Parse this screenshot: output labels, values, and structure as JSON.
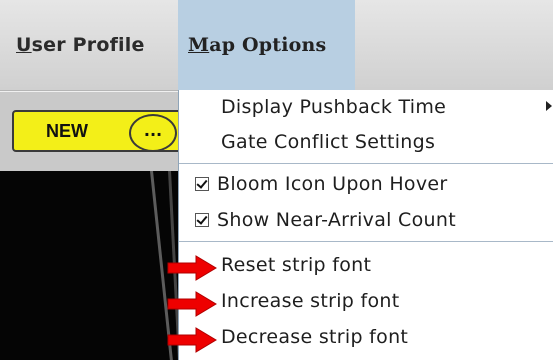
{
  "menubar": {
    "user_profile": {
      "mnemonic": "U",
      "rest": "ser Profile"
    },
    "map_options": {
      "mnemonic": "M",
      "rest": "ap Options"
    }
  },
  "toolbar": {
    "new_label": "NEW",
    "more_label": "..."
  },
  "map_options_menu": {
    "items": [
      {
        "label": "Display Pushback Time",
        "has_submenu": true
      },
      {
        "label": "Gate Conflict Settings"
      },
      {
        "label": "Bloom Icon Upon Hover",
        "checked": true
      },
      {
        "label": "Show Near-Arrival Count",
        "checked": true
      },
      {
        "label": "Reset strip font",
        "annotated": true
      },
      {
        "label": "Increase strip font",
        "annotated": true
      },
      {
        "label": "Decrease strip font",
        "annotated": true
      }
    ]
  },
  "colors": {
    "menu_highlight": "#b8cfe2",
    "new_button": "#f3ef18",
    "annotation_arrow": "#ee0000",
    "map_background": "#050505"
  },
  "icons": {
    "submenu": "chevron-right-icon",
    "check": "checkbox-checked-icon",
    "annotation": "red-arrow-icon"
  }
}
